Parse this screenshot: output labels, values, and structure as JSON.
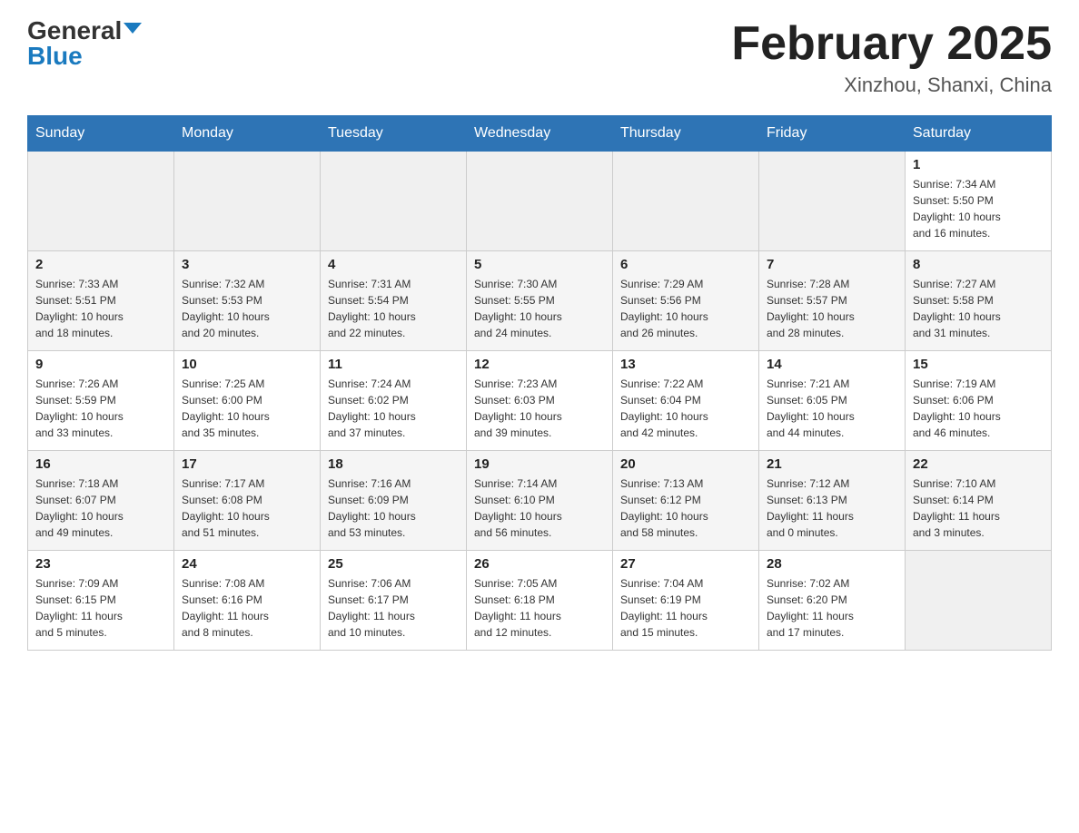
{
  "header": {
    "logo_general": "General",
    "logo_blue": "Blue",
    "month_title": "February 2025",
    "location": "Xinzhou, Shanxi, China"
  },
  "days_of_week": [
    "Sunday",
    "Monday",
    "Tuesday",
    "Wednesday",
    "Thursday",
    "Friday",
    "Saturday"
  ],
  "weeks": [
    {
      "days": [
        {
          "number": "",
          "info": ""
        },
        {
          "number": "",
          "info": ""
        },
        {
          "number": "",
          "info": ""
        },
        {
          "number": "",
          "info": ""
        },
        {
          "number": "",
          "info": ""
        },
        {
          "number": "",
          "info": ""
        },
        {
          "number": "1",
          "info": "Sunrise: 7:34 AM\nSunset: 5:50 PM\nDaylight: 10 hours\nand 16 minutes."
        }
      ]
    },
    {
      "days": [
        {
          "number": "2",
          "info": "Sunrise: 7:33 AM\nSunset: 5:51 PM\nDaylight: 10 hours\nand 18 minutes."
        },
        {
          "number": "3",
          "info": "Sunrise: 7:32 AM\nSunset: 5:53 PM\nDaylight: 10 hours\nand 20 minutes."
        },
        {
          "number": "4",
          "info": "Sunrise: 7:31 AM\nSunset: 5:54 PM\nDaylight: 10 hours\nand 22 minutes."
        },
        {
          "number": "5",
          "info": "Sunrise: 7:30 AM\nSunset: 5:55 PM\nDaylight: 10 hours\nand 24 minutes."
        },
        {
          "number": "6",
          "info": "Sunrise: 7:29 AM\nSunset: 5:56 PM\nDaylight: 10 hours\nand 26 minutes."
        },
        {
          "number": "7",
          "info": "Sunrise: 7:28 AM\nSunset: 5:57 PM\nDaylight: 10 hours\nand 28 minutes."
        },
        {
          "number": "8",
          "info": "Sunrise: 7:27 AM\nSunset: 5:58 PM\nDaylight: 10 hours\nand 31 minutes."
        }
      ]
    },
    {
      "days": [
        {
          "number": "9",
          "info": "Sunrise: 7:26 AM\nSunset: 5:59 PM\nDaylight: 10 hours\nand 33 minutes."
        },
        {
          "number": "10",
          "info": "Sunrise: 7:25 AM\nSunset: 6:00 PM\nDaylight: 10 hours\nand 35 minutes."
        },
        {
          "number": "11",
          "info": "Sunrise: 7:24 AM\nSunset: 6:02 PM\nDaylight: 10 hours\nand 37 minutes."
        },
        {
          "number": "12",
          "info": "Sunrise: 7:23 AM\nSunset: 6:03 PM\nDaylight: 10 hours\nand 39 minutes."
        },
        {
          "number": "13",
          "info": "Sunrise: 7:22 AM\nSunset: 6:04 PM\nDaylight: 10 hours\nand 42 minutes."
        },
        {
          "number": "14",
          "info": "Sunrise: 7:21 AM\nSunset: 6:05 PM\nDaylight: 10 hours\nand 44 minutes."
        },
        {
          "number": "15",
          "info": "Sunrise: 7:19 AM\nSunset: 6:06 PM\nDaylight: 10 hours\nand 46 minutes."
        }
      ]
    },
    {
      "days": [
        {
          "number": "16",
          "info": "Sunrise: 7:18 AM\nSunset: 6:07 PM\nDaylight: 10 hours\nand 49 minutes."
        },
        {
          "number": "17",
          "info": "Sunrise: 7:17 AM\nSunset: 6:08 PM\nDaylight: 10 hours\nand 51 minutes."
        },
        {
          "number": "18",
          "info": "Sunrise: 7:16 AM\nSunset: 6:09 PM\nDaylight: 10 hours\nand 53 minutes."
        },
        {
          "number": "19",
          "info": "Sunrise: 7:14 AM\nSunset: 6:10 PM\nDaylight: 10 hours\nand 56 minutes."
        },
        {
          "number": "20",
          "info": "Sunrise: 7:13 AM\nSunset: 6:12 PM\nDaylight: 10 hours\nand 58 minutes."
        },
        {
          "number": "21",
          "info": "Sunrise: 7:12 AM\nSunset: 6:13 PM\nDaylight: 11 hours\nand 0 minutes."
        },
        {
          "number": "22",
          "info": "Sunrise: 7:10 AM\nSunset: 6:14 PM\nDaylight: 11 hours\nand 3 minutes."
        }
      ]
    },
    {
      "days": [
        {
          "number": "23",
          "info": "Sunrise: 7:09 AM\nSunset: 6:15 PM\nDaylight: 11 hours\nand 5 minutes."
        },
        {
          "number": "24",
          "info": "Sunrise: 7:08 AM\nSunset: 6:16 PM\nDaylight: 11 hours\nand 8 minutes."
        },
        {
          "number": "25",
          "info": "Sunrise: 7:06 AM\nSunset: 6:17 PM\nDaylight: 11 hours\nand 10 minutes."
        },
        {
          "number": "26",
          "info": "Sunrise: 7:05 AM\nSunset: 6:18 PM\nDaylight: 11 hours\nand 12 minutes."
        },
        {
          "number": "27",
          "info": "Sunrise: 7:04 AM\nSunset: 6:19 PM\nDaylight: 11 hours\nand 15 minutes."
        },
        {
          "number": "28",
          "info": "Sunrise: 7:02 AM\nSunset: 6:20 PM\nDaylight: 11 hours\nand 17 minutes."
        },
        {
          "number": "",
          "info": ""
        }
      ]
    }
  ]
}
